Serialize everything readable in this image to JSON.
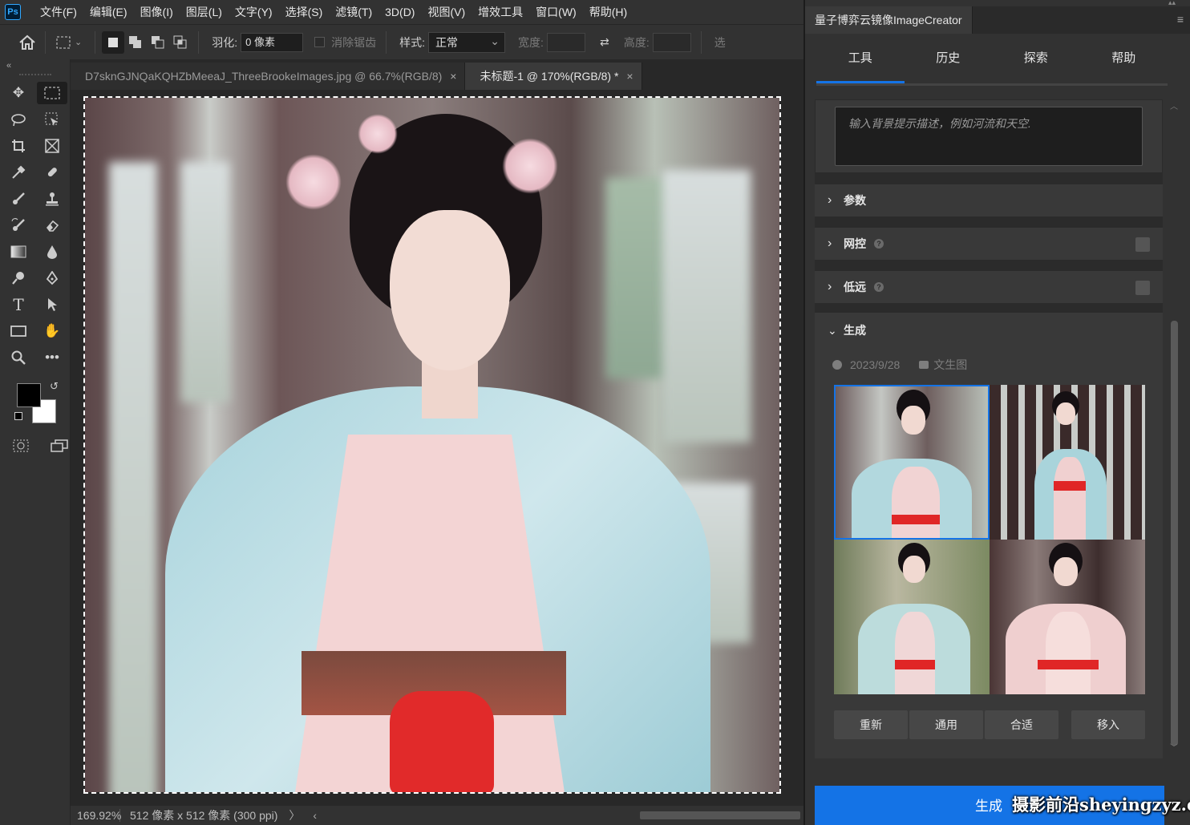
{
  "menubar": {
    "logo": "Ps",
    "items": [
      "文件(F)",
      "编辑(E)",
      "图像(I)",
      "图层(L)",
      "文字(Y)",
      "选择(S)",
      "滤镜(T)",
      "3D(D)",
      "视图(V)",
      "增效工具",
      "窗口(W)",
      "帮助(H)"
    ]
  },
  "options": {
    "feather_label": "羽化:",
    "feather_value": "0 像素",
    "antialias_label": "消除锯齿",
    "style_label": "样式:",
    "style_value": "正常",
    "width_label": "宽度:",
    "height_label": "高度:",
    "select_label": "选"
  },
  "toolbar": {
    "collapse": "«"
  },
  "doctabs": [
    {
      "label": "D7sknGJNQaKQHZbMeeaJ_ThreeBrookeImages.jpg @ 66.7%(RGB/8)",
      "close": "×",
      "active": false
    },
    {
      "label": "未标题-1 @ 170%(RGB/8) *",
      "close": "×",
      "active": true
    }
  ],
  "status": {
    "zoom": "169.92%",
    "info": "512 像素 x 512 像素 (300 ppi)",
    "arrow": "〉",
    "arrow_left": "‹"
  },
  "panel": {
    "title": "量子博弈云镜像ImageCreator",
    "menu_icon": "≡",
    "tabs": [
      "工具",
      "历史",
      "探索",
      "帮助"
    ],
    "prompt_placeholder": "输入背景提示描述，例如河流和天空.",
    "sections": {
      "params": "参数",
      "netcontrol": "网控",
      "lowfar": "低远",
      "generate": "生成"
    },
    "help_glyph": "?",
    "meta_date": "2023/9/28",
    "meta_mode": "文生图",
    "actions": [
      "重新",
      "通用",
      "合适",
      "移入"
    ],
    "generate_button": "生成"
  },
  "watermark": "摄影前沿sheyingzyz.com",
  "colors": {
    "accent": "#1473e6",
    "panel_bg": "#323232",
    "canvas_bg": "#282828"
  }
}
